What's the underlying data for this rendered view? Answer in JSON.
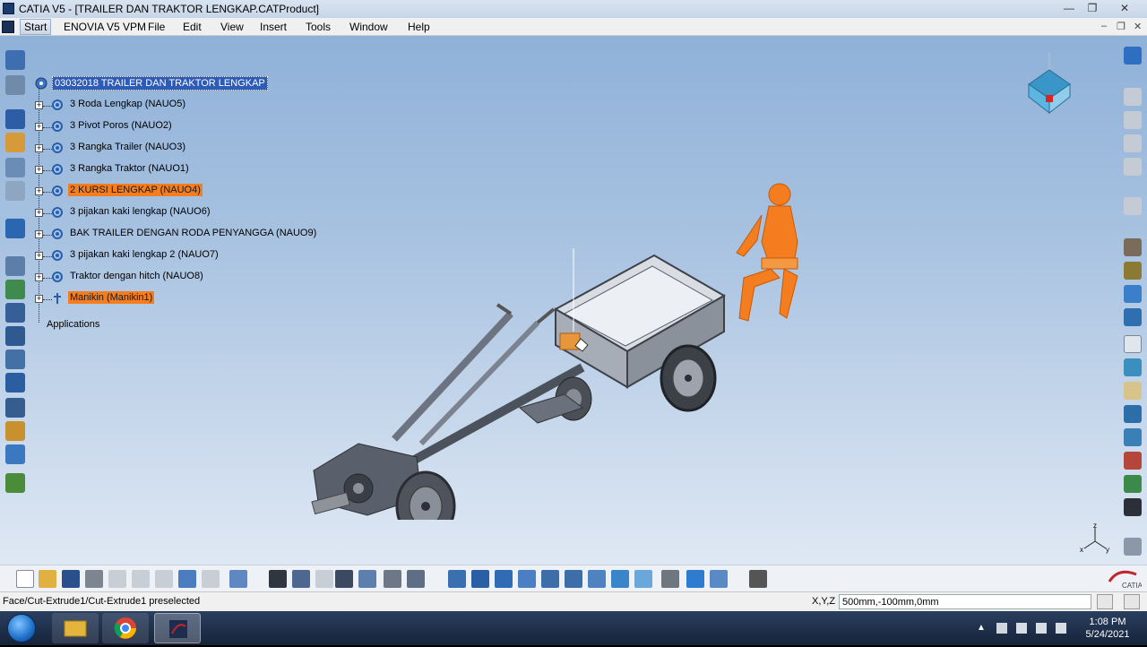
{
  "window": {
    "title": "CATIA V5 - [TRAILER DAN TRAKTOR LENGKAP.CATProduct]",
    "controls": [
      "—",
      "❐",
      "✕"
    ]
  },
  "menubar": {
    "items": [
      "Start",
      "ENOVIA V5 VPM",
      "File",
      "Edit",
      "View",
      "Insert",
      "Tools",
      "Window",
      "Help"
    ],
    "mdi_controls": [
      "–",
      "❐",
      "✕"
    ]
  },
  "tree": {
    "root": "03032018 TRAILER DAN TRAKTOR LENGKAP",
    "nodes": [
      {
        "label": "3 Roda Lengkap (NAUO5)",
        "highlight": false
      },
      {
        "label": "3 Pivot Poros (NAUO2)",
        "highlight": false
      },
      {
        "label": "3 Rangka Trailer (NAUO3)",
        "highlight": false
      },
      {
        "label": "3 Rangka Traktor (NAUO1)",
        "highlight": false
      },
      {
        "label": "2 KURSI LENGKAP (NAUO4)",
        "highlight": true
      },
      {
        "label": "3 pijakan kaki lengkap (NAUO6)",
        "highlight": false
      },
      {
        "label": "BAK TRAILER DENGAN RODA PENYANGGA (NAUO9)",
        "highlight": false
      },
      {
        "label": "3 pijakan kaki lengkap 2 (NAUO7)",
        "highlight": false
      },
      {
        "label": "Traktor dengan hitch (NAUO8)",
        "highlight": false
      },
      {
        "label": "Manikin (Manikin1)",
        "highlight": true
      }
    ],
    "applications": "Applications"
  },
  "axes": {
    "z": "z",
    "x": "x",
    "y": "y"
  },
  "status": {
    "message": "Face/Cut-Extrude1/Cut-Extrude1 preselected",
    "xyz_label": "X,Y,Z",
    "xyz_value": "500mm,-100mm,0mm"
  },
  "taskbar": {
    "time": "1:08 PM",
    "date": "5/24/2021"
  },
  "colors": {
    "highlight_orange": "#f37d1f",
    "selection_blue": "#2c5bb8",
    "viewport_top": "#8fb1d8",
    "viewport_bottom": "#dfe8f4"
  }
}
